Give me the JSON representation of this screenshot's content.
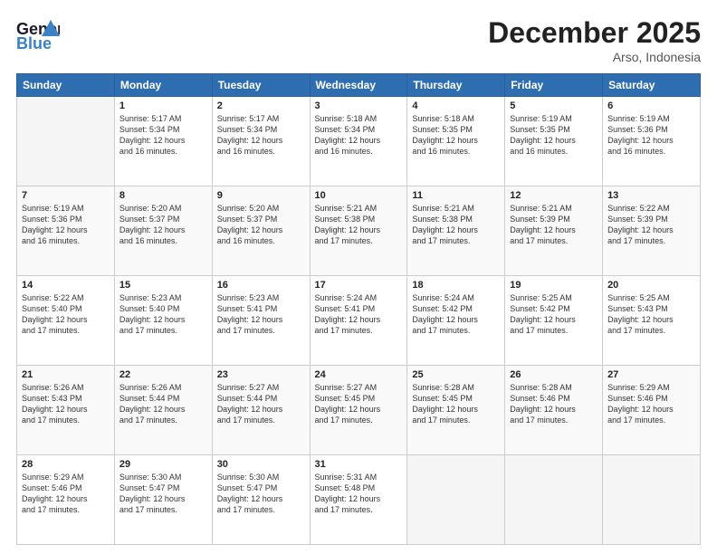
{
  "header": {
    "logo_line1": "General",
    "logo_line2": "Blue",
    "month": "December 2025",
    "location": "Arso, Indonesia"
  },
  "days_header": [
    "Sunday",
    "Monday",
    "Tuesday",
    "Wednesday",
    "Thursday",
    "Friday",
    "Saturday"
  ],
  "weeks": [
    [
      {
        "day": "",
        "info": ""
      },
      {
        "day": "1",
        "info": "Sunrise: 5:17 AM\nSunset: 5:34 PM\nDaylight: 12 hours\nand 16 minutes."
      },
      {
        "day": "2",
        "info": "Sunrise: 5:17 AM\nSunset: 5:34 PM\nDaylight: 12 hours\nand 16 minutes."
      },
      {
        "day": "3",
        "info": "Sunrise: 5:18 AM\nSunset: 5:34 PM\nDaylight: 12 hours\nand 16 minutes."
      },
      {
        "day": "4",
        "info": "Sunrise: 5:18 AM\nSunset: 5:35 PM\nDaylight: 12 hours\nand 16 minutes."
      },
      {
        "day": "5",
        "info": "Sunrise: 5:19 AM\nSunset: 5:35 PM\nDaylight: 12 hours\nand 16 minutes."
      },
      {
        "day": "6",
        "info": "Sunrise: 5:19 AM\nSunset: 5:36 PM\nDaylight: 12 hours\nand 16 minutes."
      }
    ],
    [
      {
        "day": "7",
        "info": "Sunrise: 5:19 AM\nSunset: 5:36 PM\nDaylight: 12 hours\nand 16 minutes."
      },
      {
        "day": "8",
        "info": "Sunrise: 5:20 AM\nSunset: 5:37 PM\nDaylight: 12 hours\nand 16 minutes."
      },
      {
        "day": "9",
        "info": "Sunrise: 5:20 AM\nSunset: 5:37 PM\nDaylight: 12 hours\nand 16 minutes."
      },
      {
        "day": "10",
        "info": "Sunrise: 5:21 AM\nSunset: 5:38 PM\nDaylight: 12 hours\nand 17 minutes."
      },
      {
        "day": "11",
        "info": "Sunrise: 5:21 AM\nSunset: 5:38 PM\nDaylight: 12 hours\nand 17 minutes."
      },
      {
        "day": "12",
        "info": "Sunrise: 5:21 AM\nSunset: 5:39 PM\nDaylight: 12 hours\nand 17 minutes."
      },
      {
        "day": "13",
        "info": "Sunrise: 5:22 AM\nSunset: 5:39 PM\nDaylight: 12 hours\nand 17 minutes."
      }
    ],
    [
      {
        "day": "14",
        "info": "Sunrise: 5:22 AM\nSunset: 5:40 PM\nDaylight: 12 hours\nand 17 minutes."
      },
      {
        "day": "15",
        "info": "Sunrise: 5:23 AM\nSunset: 5:40 PM\nDaylight: 12 hours\nand 17 minutes."
      },
      {
        "day": "16",
        "info": "Sunrise: 5:23 AM\nSunset: 5:41 PM\nDaylight: 12 hours\nand 17 minutes."
      },
      {
        "day": "17",
        "info": "Sunrise: 5:24 AM\nSunset: 5:41 PM\nDaylight: 12 hours\nand 17 minutes."
      },
      {
        "day": "18",
        "info": "Sunrise: 5:24 AM\nSunset: 5:42 PM\nDaylight: 12 hours\nand 17 minutes."
      },
      {
        "day": "19",
        "info": "Sunrise: 5:25 AM\nSunset: 5:42 PM\nDaylight: 12 hours\nand 17 minutes."
      },
      {
        "day": "20",
        "info": "Sunrise: 5:25 AM\nSunset: 5:43 PM\nDaylight: 12 hours\nand 17 minutes."
      }
    ],
    [
      {
        "day": "21",
        "info": "Sunrise: 5:26 AM\nSunset: 5:43 PM\nDaylight: 12 hours\nand 17 minutes."
      },
      {
        "day": "22",
        "info": "Sunrise: 5:26 AM\nSunset: 5:44 PM\nDaylight: 12 hours\nand 17 minutes."
      },
      {
        "day": "23",
        "info": "Sunrise: 5:27 AM\nSunset: 5:44 PM\nDaylight: 12 hours\nand 17 minutes."
      },
      {
        "day": "24",
        "info": "Sunrise: 5:27 AM\nSunset: 5:45 PM\nDaylight: 12 hours\nand 17 minutes."
      },
      {
        "day": "25",
        "info": "Sunrise: 5:28 AM\nSunset: 5:45 PM\nDaylight: 12 hours\nand 17 minutes."
      },
      {
        "day": "26",
        "info": "Sunrise: 5:28 AM\nSunset: 5:46 PM\nDaylight: 12 hours\nand 17 minutes."
      },
      {
        "day": "27",
        "info": "Sunrise: 5:29 AM\nSunset: 5:46 PM\nDaylight: 12 hours\nand 17 minutes."
      }
    ],
    [
      {
        "day": "28",
        "info": "Sunrise: 5:29 AM\nSunset: 5:46 PM\nDaylight: 12 hours\nand 17 minutes."
      },
      {
        "day": "29",
        "info": "Sunrise: 5:30 AM\nSunset: 5:47 PM\nDaylight: 12 hours\nand 17 minutes."
      },
      {
        "day": "30",
        "info": "Sunrise: 5:30 AM\nSunset: 5:47 PM\nDaylight: 12 hours\nand 17 minutes."
      },
      {
        "day": "31",
        "info": "Sunrise: 5:31 AM\nSunset: 5:48 PM\nDaylight: 12 hours\nand 17 minutes."
      },
      {
        "day": "",
        "info": ""
      },
      {
        "day": "",
        "info": ""
      },
      {
        "day": "",
        "info": ""
      }
    ]
  ]
}
